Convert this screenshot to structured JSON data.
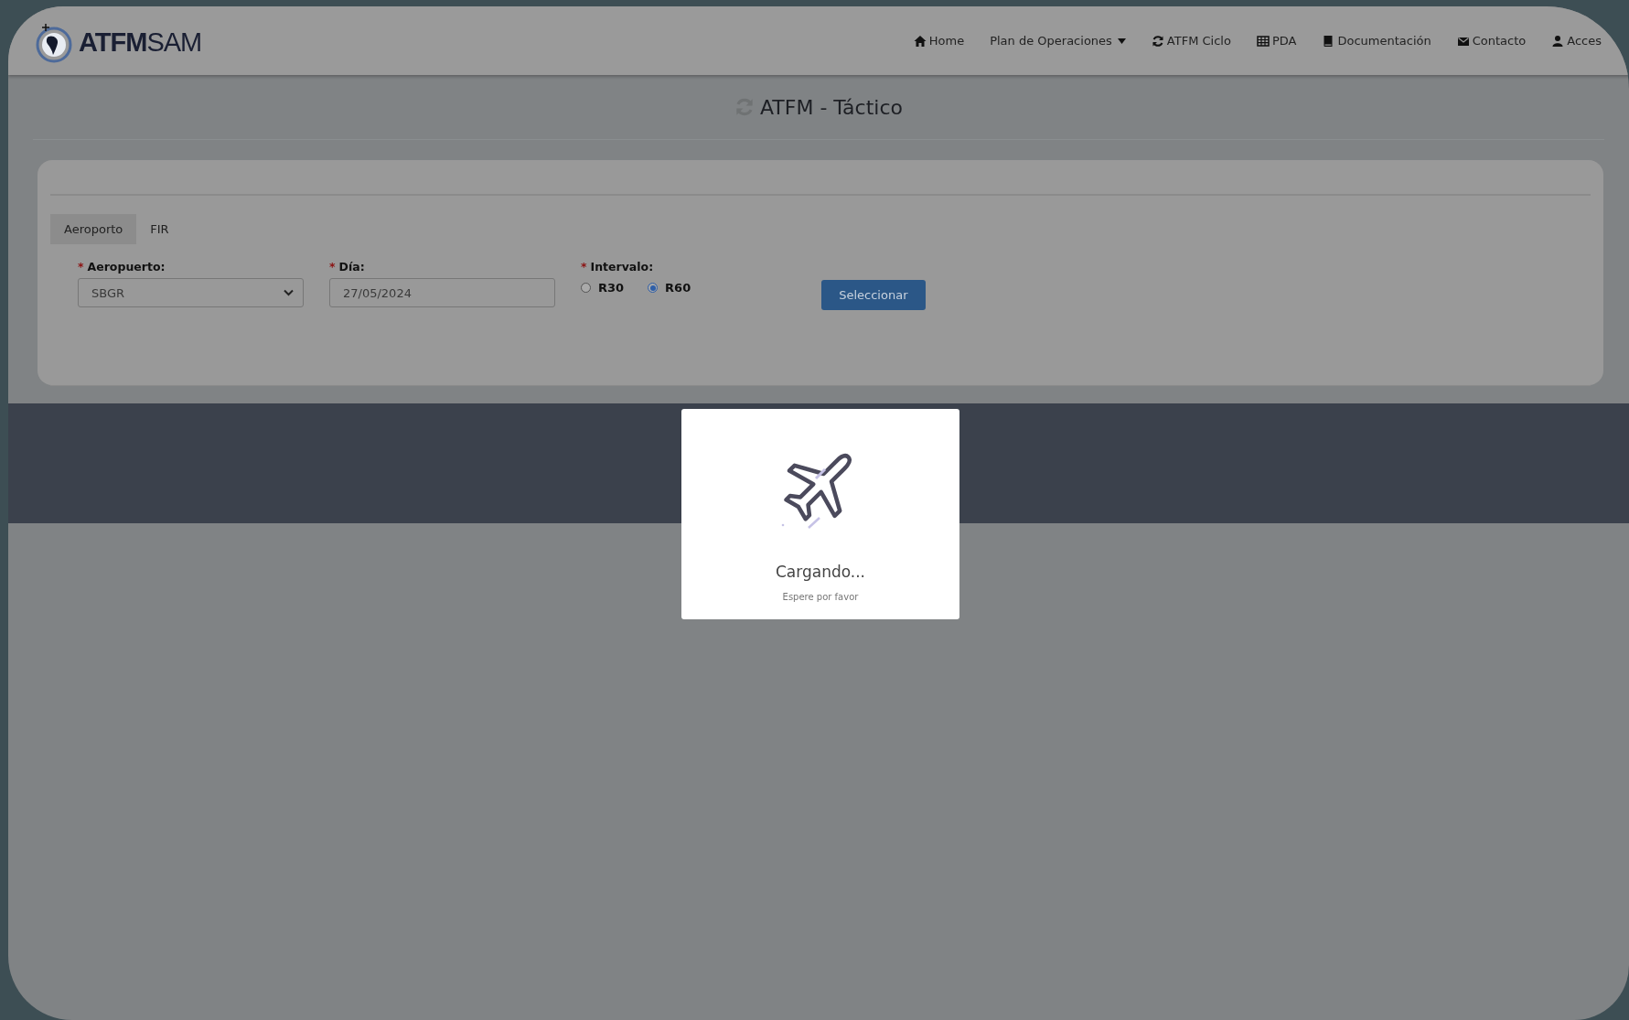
{
  "navbar": {
    "logo": {
      "bold": "ATFM",
      "light": "SAM"
    },
    "items": [
      {
        "label": "Home",
        "dropdown": false
      },
      {
        "label": "Plan de Operaciones",
        "dropdown": true
      },
      {
        "label": "ATFM Ciclo",
        "dropdown": false
      },
      {
        "label": "PDA",
        "dropdown": false
      },
      {
        "label": "Documentación",
        "dropdown": false
      },
      {
        "label": "Contacto",
        "dropdown": false
      },
      {
        "label": "Acces",
        "dropdown": false
      }
    ]
  },
  "page_title": "ATFM - Táctico",
  "tabs": [
    {
      "label": "Aeroporto",
      "selected": true
    },
    {
      "label": "FIR",
      "selected": false
    }
  ],
  "form": {
    "fields": [
      {
        "kind": "select",
        "required_mark": "*",
        "label": "Aeropuerto:",
        "value": "SBGR"
      },
      {
        "kind": "date",
        "required_mark": "*",
        "label": "Día:",
        "value": "27/05/2024"
      },
      {
        "kind": "radio",
        "required_mark": "*",
        "label": "Intervalo:",
        "options": [
          {
            "label": "R30",
            "selected": false
          },
          {
            "label": "R60",
            "selected": true
          }
        ]
      }
    ],
    "submit": "Seleccionar"
  },
  "loading_dialog": {
    "title": "Cargando...",
    "message": "Espere por favor"
  }
}
